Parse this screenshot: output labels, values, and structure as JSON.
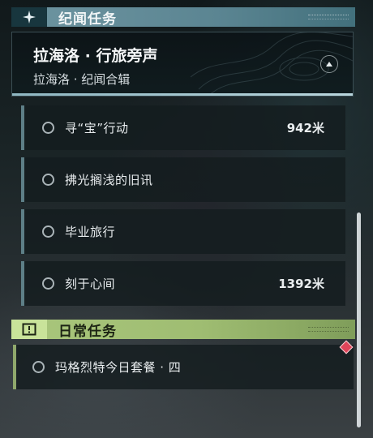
{
  "world_quests": {
    "header_title": "纪闻任务",
    "header_icon": "sparkle-star-icon",
    "chain": {
      "title": "拉海洛 · 行旅旁声",
      "subtitle": "拉海洛 · 纪闻合辑",
      "collapse_icon": "chevron-up-icon"
    },
    "quests": [
      {
        "name": "寻“宝”行动",
        "distance": "942米"
      },
      {
        "name": "拂光搁浅的旧讯",
        "distance": ""
      },
      {
        "name": "毕业旅行",
        "distance": ""
      },
      {
        "name": "刻于心间",
        "distance": "1392米"
      }
    ]
  },
  "daily_quests": {
    "header_title": "日常任务",
    "header_icon": "exclamation-box-icon",
    "quests": [
      {
        "name": "玛格烈特今日套餐 · 四",
        "distance": ""
      }
    ]
  },
  "colors": {
    "world_accent": "#6e95a1",
    "daily_accent": "#a9c67c",
    "marker": "#e0455a"
  }
}
